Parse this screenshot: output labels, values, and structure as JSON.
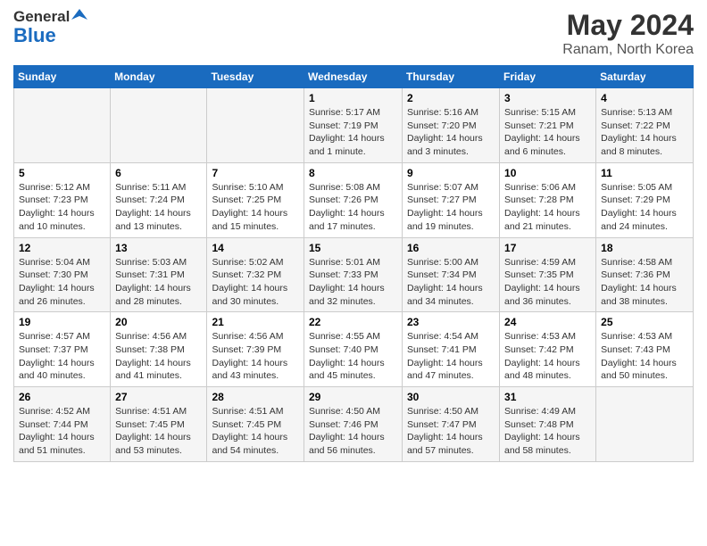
{
  "header": {
    "logo_general": "General",
    "logo_blue": "Blue",
    "month_year": "May 2024",
    "location": "Ranam, North Korea"
  },
  "days_of_week": [
    "Sunday",
    "Monday",
    "Tuesday",
    "Wednesday",
    "Thursday",
    "Friday",
    "Saturday"
  ],
  "weeks": [
    [
      {
        "day": "",
        "info": ""
      },
      {
        "day": "",
        "info": ""
      },
      {
        "day": "",
        "info": ""
      },
      {
        "day": "1",
        "info": "Sunrise: 5:17 AM\nSunset: 7:19 PM\nDaylight: 14 hours\nand 1 minute."
      },
      {
        "day": "2",
        "info": "Sunrise: 5:16 AM\nSunset: 7:20 PM\nDaylight: 14 hours\nand 3 minutes."
      },
      {
        "day": "3",
        "info": "Sunrise: 5:15 AM\nSunset: 7:21 PM\nDaylight: 14 hours\nand 6 minutes."
      },
      {
        "day": "4",
        "info": "Sunrise: 5:13 AM\nSunset: 7:22 PM\nDaylight: 14 hours\nand 8 minutes."
      }
    ],
    [
      {
        "day": "5",
        "info": "Sunrise: 5:12 AM\nSunset: 7:23 PM\nDaylight: 14 hours\nand 10 minutes."
      },
      {
        "day": "6",
        "info": "Sunrise: 5:11 AM\nSunset: 7:24 PM\nDaylight: 14 hours\nand 13 minutes."
      },
      {
        "day": "7",
        "info": "Sunrise: 5:10 AM\nSunset: 7:25 PM\nDaylight: 14 hours\nand 15 minutes."
      },
      {
        "day": "8",
        "info": "Sunrise: 5:08 AM\nSunset: 7:26 PM\nDaylight: 14 hours\nand 17 minutes."
      },
      {
        "day": "9",
        "info": "Sunrise: 5:07 AM\nSunset: 7:27 PM\nDaylight: 14 hours\nand 19 minutes."
      },
      {
        "day": "10",
        "info": "Sunrise: 5:06 AM\nSunset: 7:28 PM\nDaylight: 14 hours\nand 21 minutes."
      },
      {
        "day": "11",
        "info": "Sunrise: 5:05 AM\nSunset: 7:29 PM\nDaylight: 14 hours\nand 24 minutes."
      }
    ],
    [
      {
        "day": "12",
        "info": "Sunrise: 5:04 AM\nSunset: 7:30 PM\nDaylight: 14 hours\nand 26 minutes."
      },
      {
        "day": "13",
        "info": "Sunrise: 5:03 AM\nSunset: 7:31 PM\nDaylight: 14 hours\nand 28 minutes."
      },
      {
        "day": "14",
        "info": "Sunrise: 5:02 AM\nSunset: 7:32 PM\nDaylight: 14 hours\nand 30 minutes."
      },
      {
        "day": "15",
        "info": "Sunrise: 5:01 AM\nSunset: 7:33 PM\nDaylight: 14 hours\nand 32 minutes."
      },
      {
        "day": "16",
        "info": "Sunrise: 5:00 AM\nSunset: 7:34 PM\nDaylight: 14 hours\nand 34 minutes."
      },
      {
        "day": "17",
        "info": "Sunrise: 4:59 AM\nSunset: 7:35 PM\nDaylight: 14 hours\nand 36 minutes."
      },
      {
        "day": "18",
        "info": "Sunrise: 4:58 AM\nSunset: 7:36 PM\nDaylight: 14 hours\nand 38 minutes."
      }
    ],
    [
      {
        "day": "19",
        "info": "Sunrise: 4:57 AM\nSunset: 7:37 PM\nDaylight: 14 hours\nand 40 minutes."
      },
      {
        "day": "20",
        "info": "Sunrise: 4:56 AM\nSunset: 7:38 PM\nDaylight: 14 hours\nand 41 minutes."
      },
      {
        "day": "21",
        "info": "Sunrise: 4:56 AM\nSunset: 7:39 PM\nDaylight: 14 hours\nand 43 minutes."
      },
      {
        "day": "22",
        "info": "Sunrise: 4:55 AM\nSunset: 7:40 PM\nDaylight: 14 hours\nand 45 minutes."
      },
      {
        "day": "23",
        "info": "Sunrise: 4:54 AM\nSunset: 7:41 PM\nDaylight: 14 hours\nand 47 minutes."
      },
      {
        "day": "24",
        "info": "Sunrise: 4:53 AM\nSunset: 7:42 PM\nDaylight: 14 hours\nand 48 minutes."
      },
      {
        "day": "25",
        "info": "Sunrise: 4:53 AM\nSunset: 7:43 PM\nDaylight: 14 hours\nand 50 minutes."
      }
    ],
    [
      {
        "day": "26",
        "info": "Sunrise: 4:52 AM\nSunset: 7:44 PM\nDaylight: 14 hours\nand 51 minutes."
      },
      {
        "day": "27",
        "info": "Sunrise: 4:51 AM\nSunset: 7:45 PM\nDaylight: 14 hours\nand 53 minutes."
      },
      {
        "day": "28",
        "info": "Sunrise: 4:51 AM\nSunset: 7:45 PM\nDaylight: 14 hours\nand 54 minutes."
      },
      {
        "day": "29",
        "info": "Sunrise: 4:50 AM\nSunset: 7:46 PM\nDaylight: 14 hours\nand 56 minutes."
      },
      {
        "day": "30",
        "info": "Sunrise: 4:50 AM\nSunset: 7:47 PM\nDaylight: 14 hours\nand 57 minutes."
      },
      {
        "day": "31",
        "info": "Sunrise: 4:49 AM\nSunset: 7:48 PM\nDaylight: 14 hours\nand 58 minutes."
      },
      {
        "day": "",
        "info": ""
      }
    ]
  ]
}
